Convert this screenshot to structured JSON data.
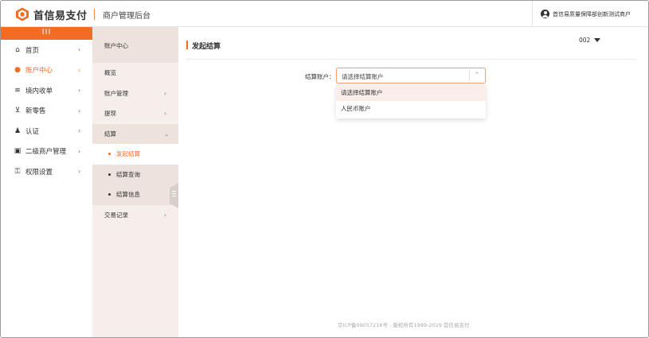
{
  "header": {
    "brand": "首信易支付",
    "subtitle": "商户管理后台",
    "user_name": "首信易质量保障部创新测试商户"
  },
  "sidebar": {
    "collapse_glyph": "III",
    "items": [
      {
        "label": "首页",
        "icon": "home-icon",
        "glyph": "⌂"
      },
      {
        "label": "账户中心",
        "icon": "user-icon",
        "glyph": "●"
      },
      {
        "label": "境内收单",
        "icon": "stack-icon",
        "glyph": "≋"
      },
      {
        "label": "新零售",
        "icon": "cart-icon",
        "glyph": "⊻"
      },
      {
        "label": "认证",
        "icon": "person-icon",
        "glyph": "♟"
      },
      {
        "label": "二级商户管理",
        "icon": "id-card-icon",
        "glyph": "▣"
      },
      {
        "label": "权限设置",
        "icon": "key-icon",
        "glyph": "⚿"
      }
    ],
    "chevron": "›"
  },
  "submenu": {
    "header": "账户中心",
    "items": {
      "overview": "概览",
      "account_mgmt": "账户管理",
      "withdraw": "提现",
      "settlement": "结算",
      "initiate": "发起结算",
      "query": "结算查询",
      "info": "结算信息",
      "transactions": "交易记录"
    },
    "chevron_right": "›",
    "chevron_down": "⌄"
  },
  "main": {
    "page_title": "发起结算",
    "top_select_value": "002",
    "form": {
      "label": "结算账户：",
      "placeholder": "请选择结算账户",
      "arrow": "^"
    },
    "dropdown_options": [
      "请选择结算账户",
      "人民币账户"
    ],
    "footer": "京ICP备09057216号 - 版权所有1999-2019 首信易支付"
  },
  "colors": {
    "accent": "#f26c24",
    "submenu_bg": "#f5eeea"
  }
}
